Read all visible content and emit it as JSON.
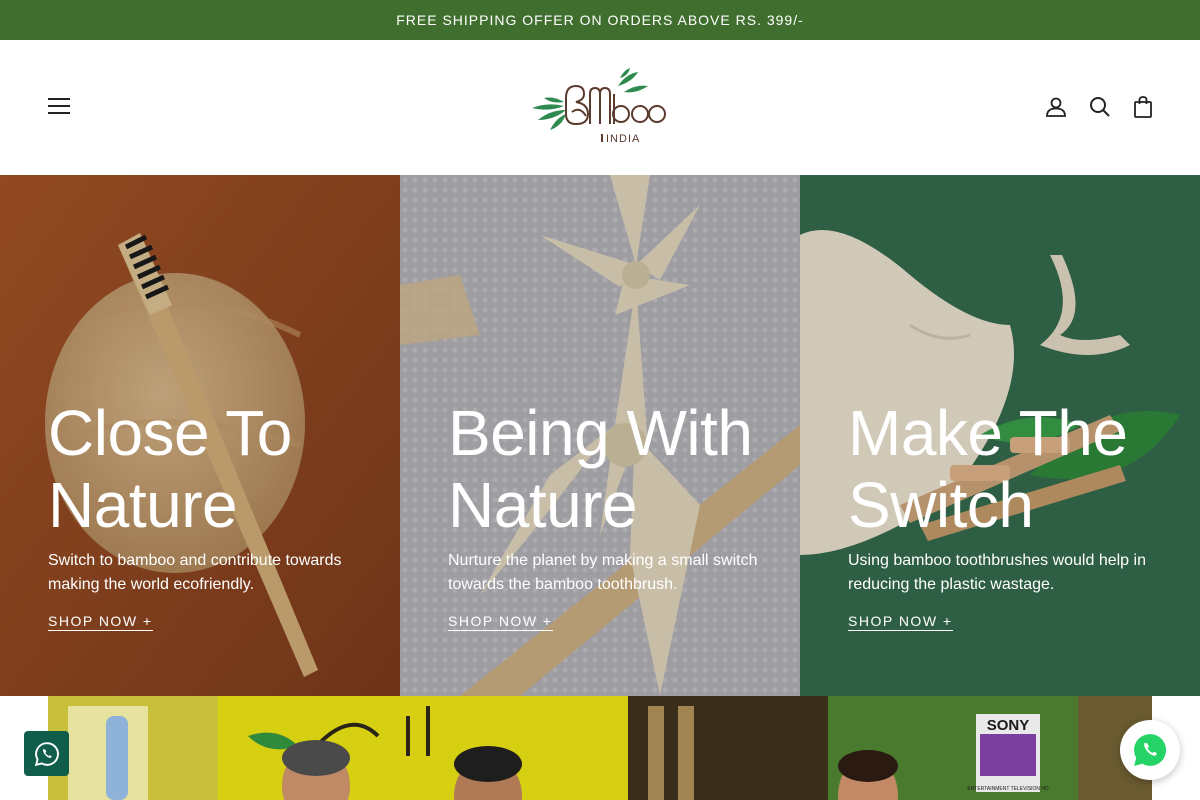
{
  "announcement": {
    "text": "FREE SHIPPING OFFER ON ORDERS ABOVE RS. 399/-"
  },
  "header": {
    "logo": {
      "wordmark": "Bamboo",
      "subtitle": "INDIA"
    },
    "icons": [
      "menu-icon",
      "account-icon",
      "search-icon",
      "cart-icon"
    ]
  },
  "hero": {
    "panels": [
      {
        "title": "Close To Nature",
        "body": "Switch to bamboo and contribute towards making the world ecofriendly.",
        "cta": "SHOP NOW +"
      },
      {
        "title": "Being With Nature",
        "body": "Nurture the planet by making a small switch towards the bamboo toothbrush.",
        "cta": "SHOP NOW +"
      },
      {
        "title": "Make The Switch",
        "body": "Using bamboo toothbrushes would help in reducing the plastic wastage.",
        "cta": "SHOP NOW +"
      }
    ]
  },
  "video_banner": {
    "channel_logo": "SONY",
    "channel_sub": "ENTERTAINMENT TELEVISION HD"
  },
  "floating": {
    "whatsapp_icons": [
      "whatsapp-icon",
      "whatsapp-icon"
    ]
  },
  "colors": {
    "announce_bg": "#3f6e2e",
    "panel1": "#9a4b22",
    "panel2": "#a8a7ad",
    "panel3": "#356b4e",
    "whatsapp_green": "#25d366",
    "whatsapp_dark": "#0f5d4a"
  }
}
